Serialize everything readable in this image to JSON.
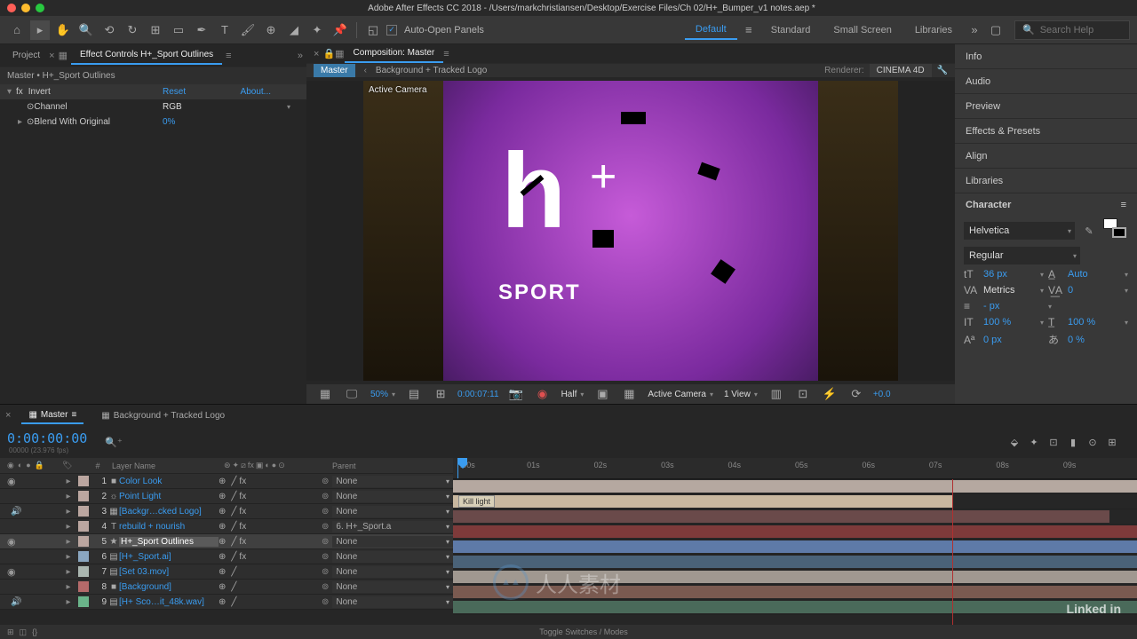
{
  "titlebar": {
    "text": "Adobe After Effects CC 2018 - /Users/markchristiansen/Desktop/Exercise Files/Ch 02/H+_Bumper_v1 notes.aep *"
  },
  "toolbar": {
    "auto_open_label": "Auto-Open Panels",
    "workspaces": [
      "Default",
      "Standard",
      "Small Screen",
      "Libraries"
    ],
    "active_workspace": "Default",
    "search_placeholder": "Search Help"
  },
  "left_panel": {
    "tabs": {
      "project": "Project",
      "effect_controls": "Effect Controls H+_Sport Outlines"
    },
    "header": "Master • H+_Sport Outlines",
    "effect": {
      "name": "Invert",
      "reset": "Reset",
      "about": "About...",
      "channel_label": "Channel",
      "channel_value": "RGB",
      "blend_label": "Blend With Original",
      "blend_value": "0%"
    }
  },
  "comp": {
    "tab_label": "Composition: Master",
    "crumb_master": "Master",
    "crumb_child": "Background + Tracked Logo",
    "renderer_label": "Renderer:",
    "renderer_value": "CINEMA 4D",
    "active_camera": "Active Camera",
    "logo": {
      "h": "h",
      "plus": "+",
      "sport": "SPORT"
    },
    "viewer_bar": {
      "zoom": "50%",
      "timecode": "0:00:07:11",
      "resolution": "Half",
      "camera": "Active Camera",
      "view": "1 View",
      "exposure": "+0.0"
    }
  },
  "right_panel": {
    "panels": [
      "Info",
      "Audio",
      "Preview",
      "Effects & Presets",
      "Align",
      "Libraries"
    ],
    "character": {
      "title": "Character",
      "font": "Helvetica",
      "style": "Regular",
      "size": "36 px",
      "leading": "Auto",
      "kerning": "Metrics",
      "tracking": "0",
      "stroke_w": "- px",
      "vscale": "100 %",
      "hscale": "100 %",
      "baseline": "0 px",
      "tsume": "0 %"
    }
  },
  "timeline": {
    "tabs": {
      "master": "Master",
      "bg": "Background + Tracked Logo"
    },
    "timecode": "0:00:00:00",
    "fps": "00000 (23.976 fps)",
    "columns": {
      "num": "#",
      "name": "Layer Name",
      "parent": "Parent"
    },
    "time_ticks": [
      ":00s",
      "01s",
      "02s",
      "03s",
      "04s",
      "05s",
      "06s",
      "07s",
      "08s",
      "09s"
    ],
    "marker_text": "Kill light",
    "layers": [
      {
        "num": "1",
        "color": "#bba6a0",
        "icon": "■",
        "name": "Color Look",
        "parent": "None",
        "bar_color": "#b5a8a0",
        "bar_start": 0,
        "bar_end": 100
      },
      {
        "num": "2",
        "color": "#bba6a0",
        "icon": "☼",
        "name": "Point Light",
        "parent": "None",
        "bar_color": "#c9b8a0",
        "bar_start": 0,
        "bar_end": 73
      },
      {
        "num": "3",
        "color": "#bba6a0",
        "icon": "▦",
        "name": "[Backgr…cked Logo]",
        "parent": "None",
        "bar_color": "#6a4a4a",
        "bar_start": 0,
        "bar_end": 96
      },
      {
        "num": "4",
        "color": "#bba6a0",
        "icon": "T",
        "name": "rebuild + nourish",
        "parent": "6. H+_Sport.a",
        "bar_color": "#7e3a3a",
        "bar_start": 0,
        "bar_end": 100
      },
      {
        "num": "5",
        "color": "#bba6a0",
        "icon": "★",
        "name": "H+_Sport Outlines",
        "parent": "None",
        "bar_color": "#5e7aa8",
        "bar_start": 0,
        "bar_end": 100,
        "selected": true
      },
      {
        "num": "6",
        "color": "#8aa6c0",
        "icon": "▤",
        "name": "[H+_Sport.ai]",
        "parent": "None",
        "bar_color": "#4a6278",
        "bar_start": 0,
        "bar_end": 100
      },
      {
        "num": "7",
        "color": "#aab6b0",
        "icon": "▤",
        "name": "[Set 03.mov]",
        "parent": "None",
        "bar_color": "#a09890",
        "bar_start": 0,
        "bar_end": 100
      },
      {
        "num": "8",
        "color": "#b46a6a",
        "icon": "■",
        "name": "[Background]",
        "parent": "None",
        "bar_color": "#7a5a50",
        "bar_start": 0,
        "bar_end": 100
      },
      {
        "num": "9",
        "color": "#6ab48a",
        "icon": "▤",
        "name": "[H+ Sco…it_48k.wav]",
        "parent": "None",
        "bar_color": "#4a6a5a",
        "bar_start": 0,
        "bar_end": 100
      }
    ],
    "footer": "Toggle Switches / Modes"
  },
  "branding": {
    "linkedin": "Linked in"
  }
}
